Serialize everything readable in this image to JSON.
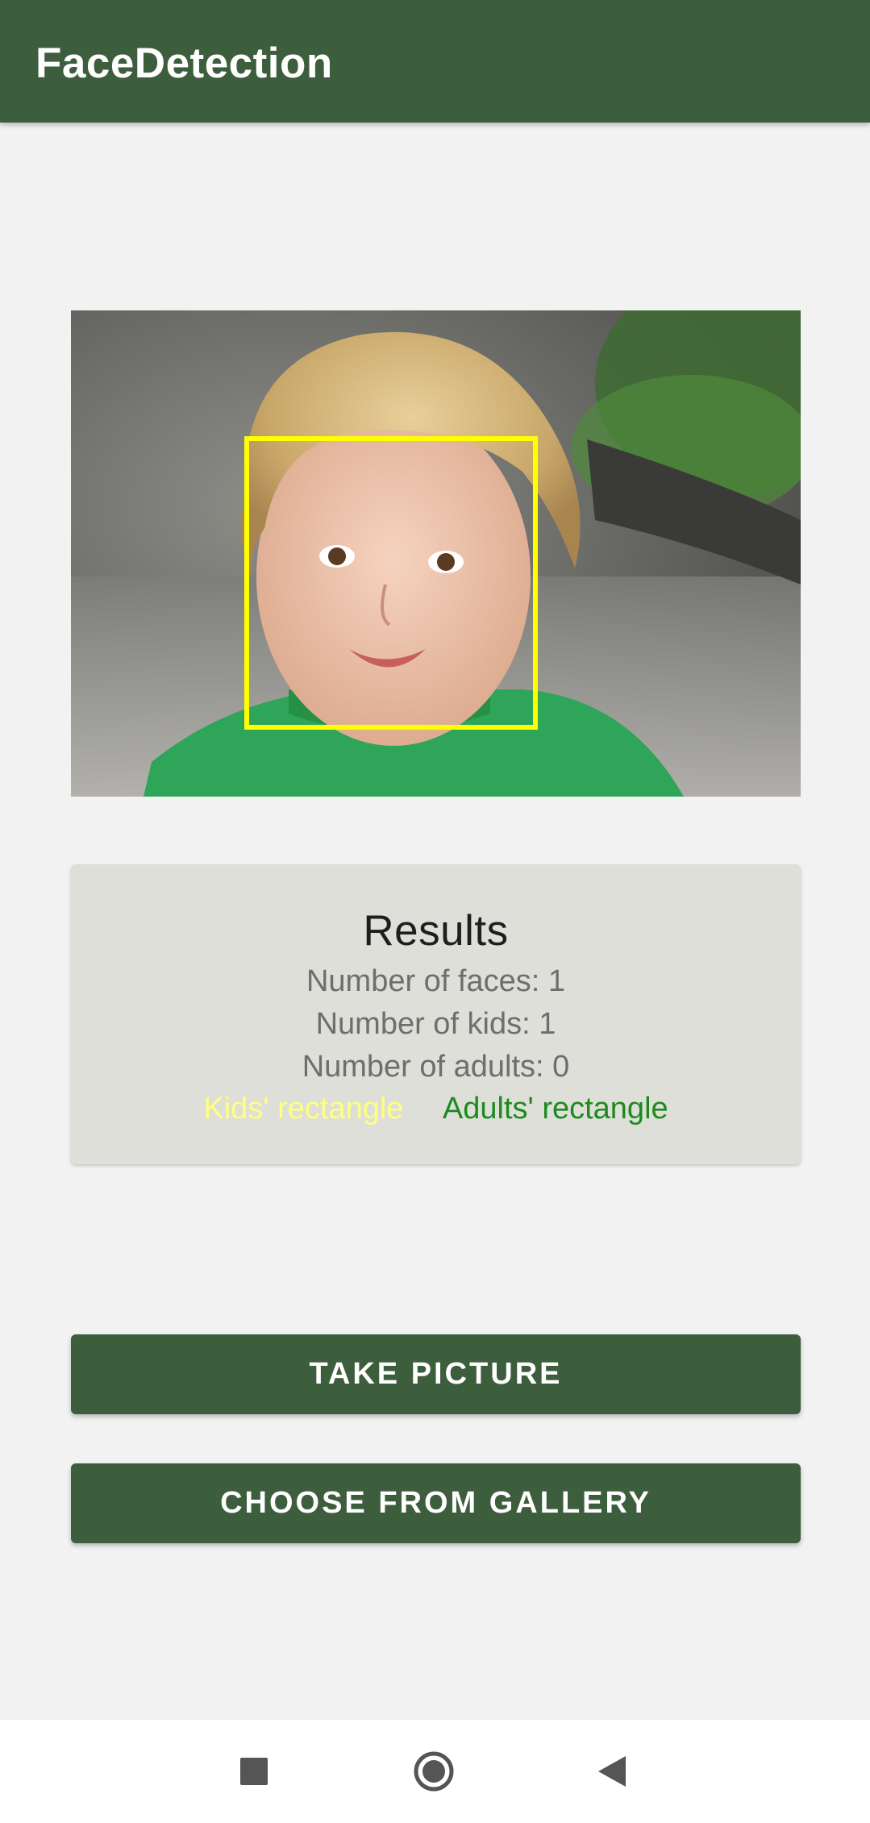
{
  "app_bar": {
    "title": "FaceDetection",
    "color": "#3d5e3c"
  },
  "photo": {
    "description_icon": "photo-of-child",
    "face_box_color": "#ffff00"
  },
  "results": {
    "title": "Results",
    "faces_line": "Number of faces: 1",
    "kids_line": "Number of kids: 1",
    "adults_line": "Number of adults: 0",
    "kids_legend": "Kids' rectangle",
    "adults_legend": "Adults' rectangle",
    "kids_color": "#ffff00",
    "adults_color": "#1e8a1e"
  },
  "buttons": {
    "take_picture": "Take picture",
    "choose_gallery": "Choose from gallery"
  },
  "nav": {
    "recents_icon": "square-icon",
    "home_icon": "circle-icon",
    "back_icon": "triangle-back-icon"
  }
}
